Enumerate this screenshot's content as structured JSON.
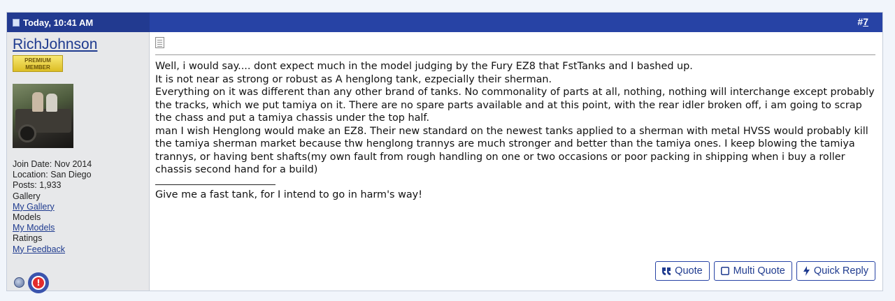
{
  "post": {
    "date": "Today, 10:41 AM",
    "number_prefix": "#",
    "number": "7"
  },
  "user": {
    "username": "RichJohnson",
    "badge_line1": "PREMIUM",
    "badge_line2": "MEMBER",
    "join_date": "Join Date: Nov 2014",
    "location": "Location: San Diego",
    "posts": "Posts: 1,933",
    "gallery_label": "Gallery",
    "gallery_link": "My Gallery",
    "models_label": "Models",
    "models_link": "My Models",
    "ratings_label": "Ratings",
    "ratings_link": "My Feedback",
    "report_symbol": "!"
  },
  "message": {
    "lines": [
      "Well, i would say.... dont expect much in the model judging by the Fury EZ8 that FstTanks and I bashed up.",
      "It is not near as strong or robust as A henglong tank, ezpecially their sherman.",
      "Everything on it was different than any other brand of tanks. No commonality of parts at all, nothing, nothing will interchange except probably the tracks, which we put tamiya on it. There are no spare parts available and at this point, with the rear idler broken off, i am going to scrap the chass and put a tamiya chassis under the top half.",
      "man I wish Henglong would make an EZ8. Their new standard on the newest tanks applied to a sherman with metal HVSS would probably kill the tamiya sherman market because thw henglong trannys are much stronger and better than the tamiya ones. I keep blowing the tamiya trannys, or having bent shafts(my own fault from rough handling on one or two occasions or poor packing in shipping when i buy a roller chassis second hand for a build)"
    ],
    "signature": "Give me a fast tank, for I intend to go in harm's way!"
  },
  "buttons": {
    "quote": "Quote",
    "multi_quote": "Multi Quote",
    "quick_reply": "Quick Reply"
  },
  "colors": {
    "header": "#2743a5",
    "user_panel": "#e7e8ea",
    "link": "#1f3b8f"
  },
  "icons": [
    "post-date-icon",
    "post-icon",
    "online-status-icon",
    "report-post-icon",
    "quote-icon",
    "multi-quote-checkbox-icon",
    "quick-reply-bolt-icon"
  ]
}
